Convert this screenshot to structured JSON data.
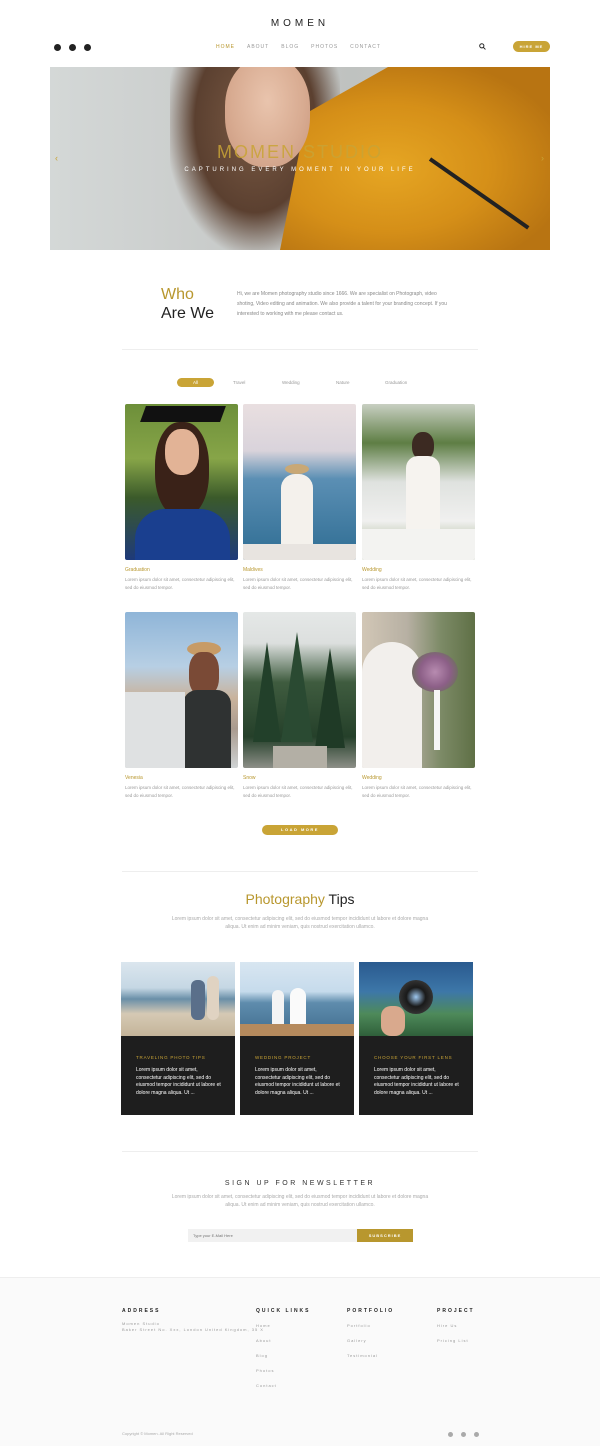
{
  "header": {
    "brand": "MOMEN",
    "social_icons": [
      "facebook-icon",
      "twitter-icon",
      "youtube-icon"
    ],
    "nav": [
      {
        "label": "HOME",
        "active": true
      },
      {
        "label": "ABOUT",
        "active": false
      },
      {
        "label": "BLOG",
        "active": false
      },
      {
        "label": "PHOTOS",
        "active": false
      },
      {
        "label": "CONTACT",
        "active": false
      }
    ],
    "hire_label": "HIRE ME",
    "accent": "#c9a436"
  },
  "hero": {
    "title": "MOMEN STUDIO",
    "subtitle": "CAPTURING EVERY MOMENT IN YOUR LIFE",
    "prev": "‹",
    "next": "›"
  },
  "about": {
    "heading_accent": "Who",
    "heading_rest": "Are We",
    "text": "Hi, we are Momen photography studio since 1666. We are specialist on Photograph, video shoting, Video editing and animation. We also provide a talent for your branding concept. If you interested to working with me please contact us."
  },
  "filters": [
    "All",
    "Travel",
    "Wedding",
    "Nature",
    "Graduation"
  ],
  "gallery": [
    {
      "title": "Graduation",
      "desc": "Lorem ipsum dolor sit amet, consectetur adipiscing elit, sed do eiusmod tempor."
    },
    {
      "title": "Maldives",
      "desc": "Lorem ipsum dolor sit amet, consectetur adipiscing elit, sed do eiusmod tempor."
    },
    {
      "title": "Wedding",
      "desc": "Lorem ipsum dolor sit amet, consectetur adipiscing elit, sed do eiusmod tempor."
    },
    {
      "title": "Venesia",
      "desc": "Lorem ipsum dolor sit amet, consectetur adipiscing elit, sed do eiusmod tempor."
    },
    {
      "title": "Snow",
      "desc": "Lorem ipsum dolor sit amet, consectetur adipiscing elit, sed do eiusmod tempor."
    },
    {
      "title": "Wedding",
      "desc": "Lorem ipsum dolor sit amet, consectetur adipiscing elit, sed do eiusmod tempor."
    }
  ],
  "load_more": "LOAD MORE",
  "tips": {
    "title_accent": "Photography",
    "title_rest": "Tips",
    "subtitle": "Lorem ipsum dolor sit amet, consectetur adipiscing elit, sed do eiusmod tempor incididunt ut labore et dolore magna aliqua. Ut enim ad minim veniam, quis nostrud exercitation ullamco.",
    "items": [
      {
        "category": "TRAVELING PHOTO TIPS",
        "text": "Lorem ipsum dolor sit amet, consectetur adipiscing elit, sed do eiusmod tempor incididunt ut labore et dolore magna aliqua. Ut ..."
      },
      {
        "category": "WEDDING PROJECT",
        "text": "Lorem ipsum dolor sit amet, consectetur adipiscing elit, sed do eiusmod tempor incididunt ut labore et dolore magna aliqua. Ut ..."
      },
      {
        "category": "CHOOSE YOUR FIRST LENS",
        "text": "Lorem ipsum dolor sit amet, consectetur adipiscing elit, sed do eiusmod tempor incididunt ut labore et dolore magna aliqua. Ut ..."
      }
    ]
  },
  "newsletter": {
    "title": "SIGN UP FOR NEWSLETTER",
    "subtitle": "Lorem ipsum dolor sit amet, consectetur adipiscing elit, sed do eiusmod tempor incididunt ut labore et dolore magna aliqua. Ut enim ad minim veniam, quis nostrud exercitation ullamco.",
    "placeholder": "Type your E-Mail Here",
    "button": "SUBSCRIBE"
  },
  "footer": {
    "address": {
      "heading": "ADDRESS",
      "line1": "Momen Studio",
      "line2": "Baker Street No. Xxx, London United Kingdom, 35 X"
    },
    "quick_links": {
      "heading": "QUICK LINKS",
      "links": [
        "Home",
        "About",
        "Blog",
        "Photos",
        "Contact"
      ]
    },
    "portfolio": {
      "heading": "PORTFOLIO",
      "links": [
        "Portfolio",
        "Gallery",
        "Testimonial"
      ]
    },
    "project": {
      "heading": "PROJECT",
      "links": [
        "Hire Us",
        "Pricing List"
      ]
    },
    "copyright": "Copyright © Momen. All Right Reserved",
    "social_icons": [
      "facebook-icon",
      "twitter-icon",
      "instagram-icon"
    ]
  }
}
